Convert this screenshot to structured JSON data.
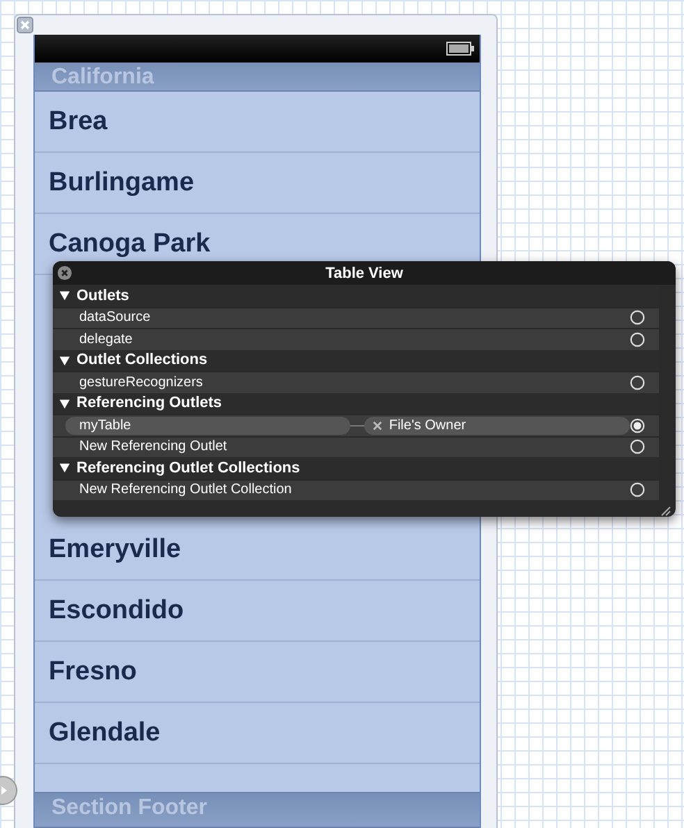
{
  "table": {
    "section_header": "California",
    "rows_above": [
      "Brea",
      "Burlingame",
      "Canoga Park"
    ],
    "rows_below": [
      "Emeryville",
      "Escondido",
      "Fresno",
      "Glendale"
    ],
    "section_footer": "Section Footer"
  },
  "inspector": {
    "title": "Table View",
    "sections": [
      {
        "title": "Outlets",
        "expanded": true,
        "items": [
          {
            "name": "dataSource",
            "connected": false
          },
          {
            "name": "delegate",
            "connected": false
          }
        ]
      },
      {
        "title": "Outlet Collections",
        "expanded": true,
        "items": [
          {
            "name": "gestureRecognizers",
            "connected": false
          }
        ]
      },
      {
        "title": "Referencing Outlets",
        "expanded": true,
        "items": [
          {
            "name": "myTable",
            "connected": true,
            "target": "File's Owner"
          },
          {
            "name": "New Referencing Outlet",
            "connected": false
          }
        ]
      },
      {
        "title": "Referencing Outlet Collections",
        "expanded": true,
        "items": [
          {
            "name": "New Referencing Outlet Collection",
            "connected": false
          }
        ]
      }
    ]
  }
}
